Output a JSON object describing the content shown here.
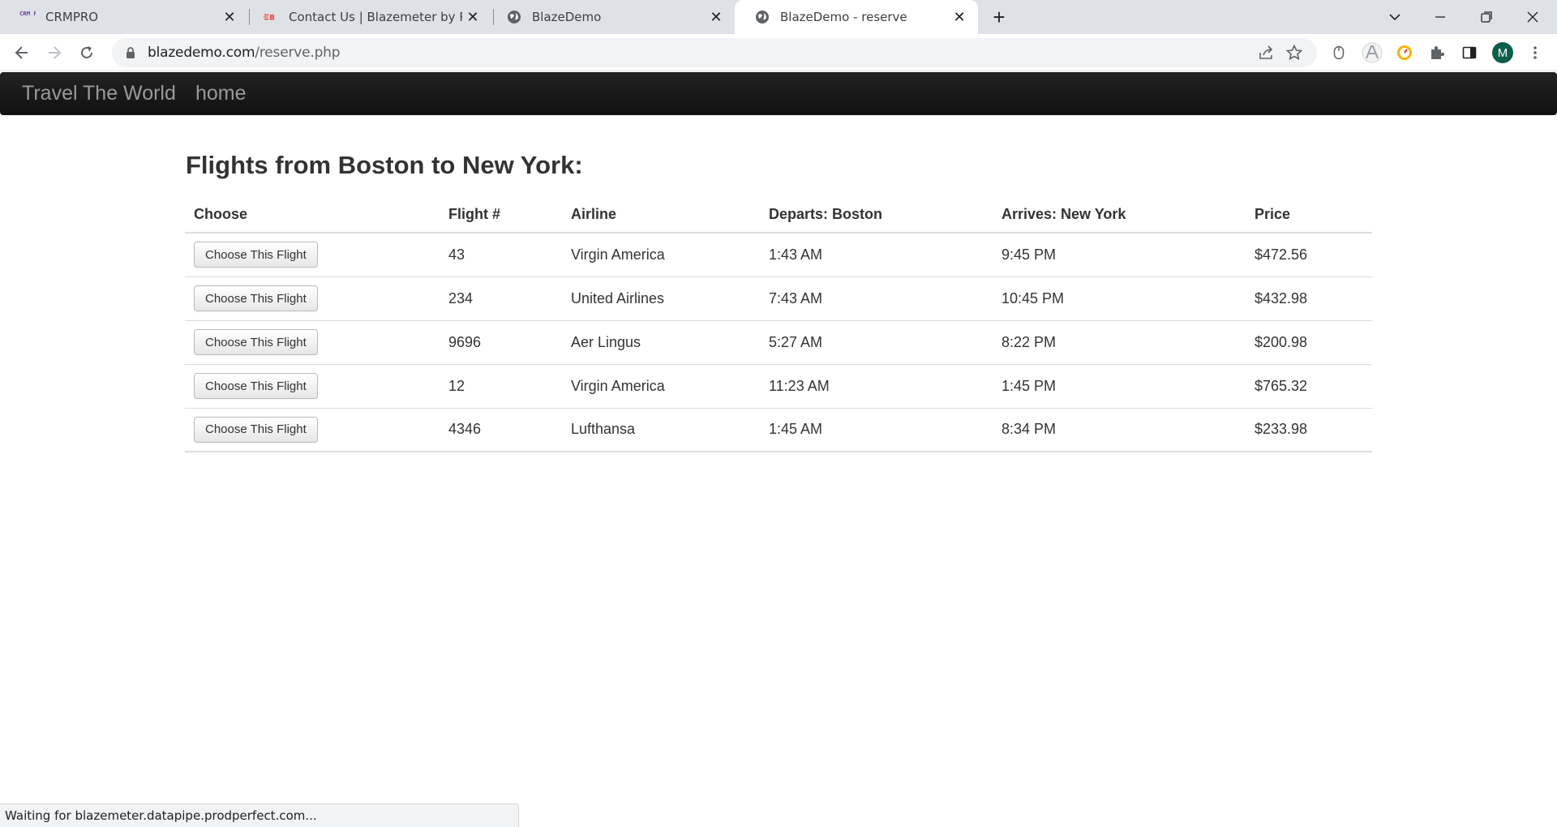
{
  "browser": {
    "tabs": [
      {
        "title": "CRMPRO",
        "favicon": "crmpro-logo-icon",
        "active": false
      },
      {
        "title": "Contact Us | Blazemeter by Perfo",
        "favicon": "blazemeter-logo-icon",
        "active": false
      },
      {
        "title": "BlazeDemo",
        "favicon": "globe-icon",
        "active": false
      },
      {
        "title": "BlazeDemo - reserve",
        "favicon": "globe-icon",
        "active": true
      }
    ],
    "favicon_text": {
      "crmpro": "CRM PRO",
      "blazemeter": "B"
    },
    "url": {
      "host": "blazedemo.com",
      "path": "/reserve.php"
    },
    "avatar_initial": "M",
    "status_text": "Waiting for blazemeter.datapipe.prodperfect.com..."
  },
  "navbar": {
    "brand": "Travel The World",
    "home_link": "home"
  },
  "page": {
    "title": "Flights from Boston to New York:",
    "table": {
      "headers": [
        "Choose",
        "Flight #",
        "Airline",
        "Departs: Boston",
        "Arrives: New York",
        "Price"
      ],
      "button_label": "Choose This Flight",
      "rows": [
        {
          "flight": "43",
          "airline": "Virgin America",
          "departs": "1:43 AM",
          "arrives": "9:45 PM",
          "price": "$472.56"
        },
        {
          "flight": "234",
          "airline": "United Airlines",
          "departs": "7:43 AM",
          "arrives": "10:45 PM",
          "price": "$432.98"
        },
        {
          "flight": "9696",
          "airline": "Aer Lingus",
          "departs": "5:27 AM",
          "arrives": "8:22 PM",
          "price": "$200.98"
        },
        {
          "flight": "12",
          "airline": "Virgin America",
          "departs": "11:23 AM",
          "arrives": "1:45 PM",
          "price": "$765.32"
        },
        {
          "flight": "4346",
          "airline": "Lufthansa",
          "departs": "1:45 AM",
          "arrives": "8:34 PM",
          "price": "$233.98"
        }
      ]
    }
  },
  "colors": {
    "navbar_bg": "#1b1b1b",
    "navbar_text": "#999999",
    "tabstrip_bg": "#dee1e6",
    "avatar_bg": "#0b5e4a"
  }
}
